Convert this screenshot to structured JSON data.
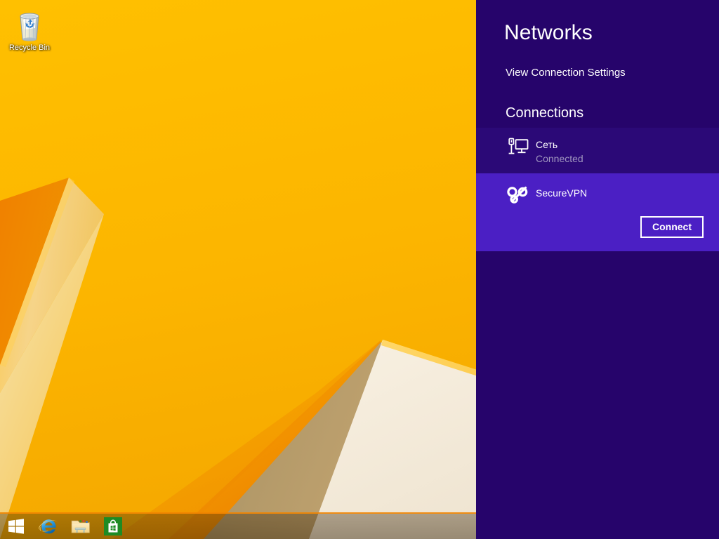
{
  "desktop": {
    "icons": [
      {
        "name": "Recycle Bin",
        "icon": "recycle-bin-icon",
        "label": "Recycle Bin"
      }
    ],
    "wallpaper_colors": {
      "primary_yellow": "#fcb700",
      "orange": "#f08a00",
      "dark_orange": "#e07b00",
      "cream": "#f3ead9",
      "tan": "#b39a6e"
    }
  },
  "taskbar": {
    "buttons": [
      {
        "name": "start-button",
        "label": "Start",
        "icon": "windows-logo-icon"
      },
      {
        "name": "internet-explorer-button",
        "label": "Internet Explorer",
        "icon": "internet-explorer-icon"
      },
      {
        "name": "file-explorer-button",
        "label": "File Explorer",
        "icon": "file-explorer-icon"
      },
      {
        "name": "store-button",
        "label": "Store",
        "icon": "windows-store-icon"
      }
    ]
  },
  "networks_panel": {
    "title": "Networks",
    "view_settings_label": "View Connection Settings",
    "connections_heading": "Connections",
    "accent_color": "#4b1fc4",
    "background_color": "#26046b",
    "connections": [
      {
        "name": "Сеть",
        "status": "Connected",
        "icon": "ethernet-monitor-icon",
        "selected": false
      },
      {
        "name": "SecureVPN",
        "status": "",
        "icon": "vpn-key-icon",
        "selected": true,
        "action_label": "Connect"
      }
    ]
  }
}
